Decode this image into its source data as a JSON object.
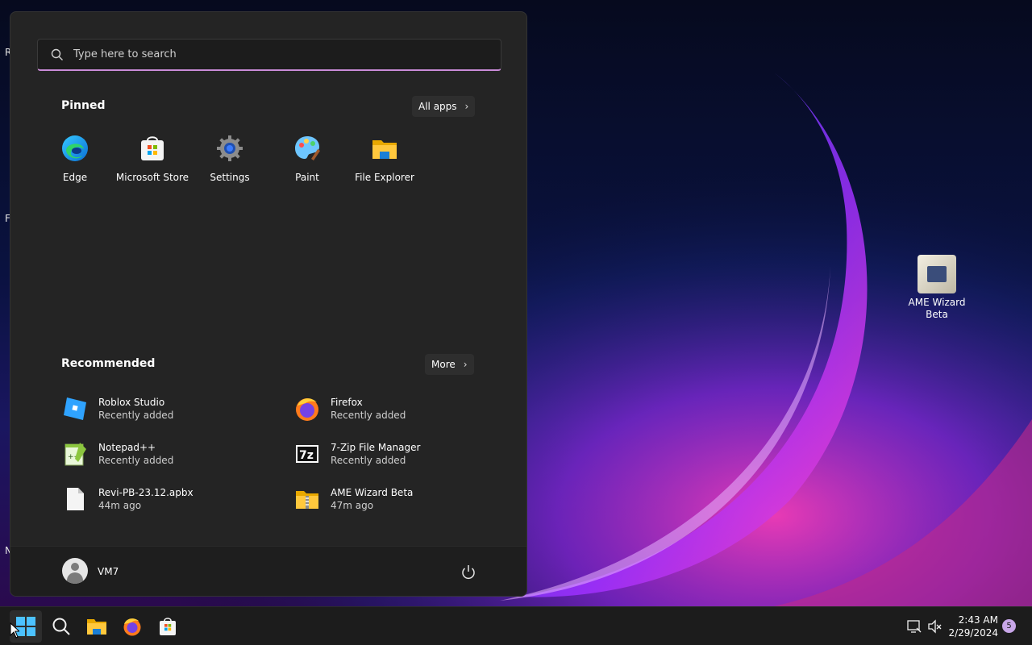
{
  "desktop": {
    "edge_letters": [
      "R",
      "Fi",
      "N"
    ],
    "icons": [
      {
        "label": "AME Wizard Beta",
        "icon": "ame-wizard-icon"
      }
    ]
  },
  "start_menu": {
    "search": {
      "placeholder": "Type here to search"
    },
    "pinned": {
      "title": "Pinned",
      "all_apps_label": "All apps",
      "items": [
        {
          "label": "Edge",
          "icon": "edge-icon"
        },
        {
          "label": "Microsoft Store",
          "icon": "store-icon"
        },
        {
          "label": "Settings",
          "icon": "settings-icon"
        },
        {
          "label": "Paint",
          "icon": "paint-icon"
        },
        {
          "label": "File Explorer",
          "icon": "folder-icon"
        }
      ]
    },
    "recommended": {
      "title": "Recommended",
      "more_label": "More",
      "items": [
        {
          "name": "Roblox Studio",
          "sub": "Recently added",
          "icon": "roblox-studio-icon"
        },
        {
          "name": "Firefox",
          "sub": "Recently added",
          "icon": "firefox-icon"
        },
        {
          "name": "Notepad++",
          "sub": "Recently added",
          "icon": "notepadpp-icon"
        },
        {
          "name": "7-Zip File Manager",
          "sub": "Recently added",
          "icon": "7zip-icon"
        },
        {
          "name": "Revi-PB-23.12.apbx",
          "sub": "44m ago",
          "icon": "file-icon"
        },
        {
          "name": "AME Wizard Beta",
          "sub": "47m ago",
          "icon": "zip-folder-icon"
        }
      ]
    },
    "user": {
      "name": "VM7"
    }
  },
  "taskbar": {
    "clock": {
      "time": "2:43 AM",
      "date": "2/29/2024"
    },
    "notification_count": "5",
    "accent": "#4cc2ff"
  }
}
